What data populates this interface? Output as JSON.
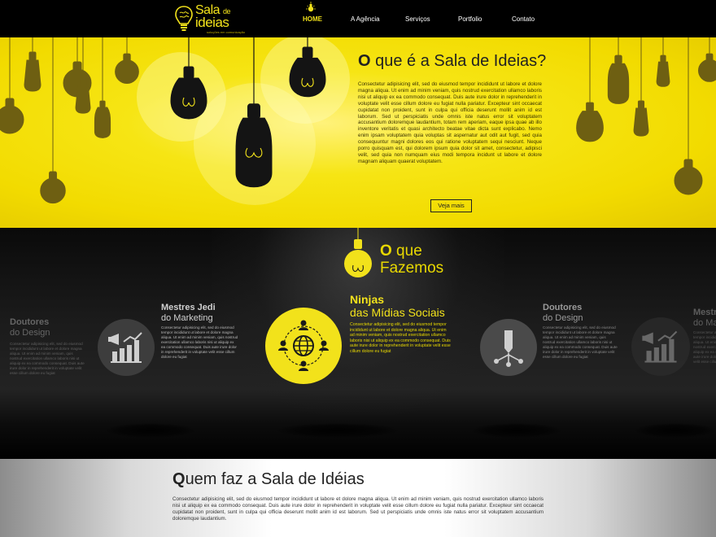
{
  "brand": {
    "name_line1": "Sala",
    "name_de": "de",
    "name_line2": "ideias",
    "tagline": "soluções em comunicação"
  },
  "nav": {
    "items": [
      {
        "label": "HOME",
        "active": true
      },
      {
        "label": "A Agência",
        "active": false
      },
      {
        "label": "Serviços",
        "active": false
      },
      {
        "label": "Portfolio",
        "active": false
      },
      {
        "label": "Contato",
        "active": false
      }
    ]
  },
  "hero": {
    "title_first": "O",
    "title_rest": " que é a Sala de Ideias?",
    "body": "Consectetur adipisicing elit, sed do eiusmod tempor incididunt ut labore et dolore magna aliqua. Ut enim ad minim veniam, quis nostrud exercitation ullamco laboris nisi ut aliquip ex ea commodo consequat. Duis aute irure dolor in reprehenderit in voluptate velit esse cillum dolore eu fugiat nulla pariatur. Excepteur sint occaecat cupidatat non proident, sunt in culpa qui officia deserunt mollit anim id est laborum. Sed ut perspiciatis unde omnis iste natus error sit voluptatem accusantium doloremque laudantium, totam rem aperiam, eaque ipsa quae ab illo inventore veritatis et quasi architecto beatae vitae dicta sunt explicabo. Nemo enim ipsam voluptatem quia voluptas sit aspernatur aut odit aut fugit, sed quia consequuntur magni dolores eos qui ratione voluptatem sequi nesciunt. Neque porro quisquam est, qui dolorem ipsum quia dolor sit amet, consectetur, adipisci velit, sed quia non numquam eius modi tempora incidunt ut labore et dolore magnam aliquam quaerat voluptatem.",
    "button": "Veja mais"
  },
  "services": {
    "heading_first": "O",
    "heading_rest": " que",
    "heading_line2": "Fazemos",
    "cards": [
      {
        "title": "Doutores",
        "subtitle": "do Design",
        "desc": "Consectetur adipisicing elit, sed do eiusmod tempor incididunt ut labore et dolore magna aliqua. Ut enim ad minim veniam, quis nostrud exercitation ullamco laboris nisi ut aliquip ex ea commodo consequat. Duis aute irure dolor in reprehenderit in voluptate velit esse cillum dolore eu fugiat",
        "icon": "pencil-network-icon"
      },
      {
        "title": "Mestres Jedi",
        "subtitle": "do Marketing",
        "desc": "Consectetur adipisicing elit, sed do eiusmod tempor incididunt ut labore et dolore magna aliqua. Ut enim ad minim veniam, quis nostrud exercitation ullamco laboris nisi ut aliquip ex ea commodo consequat. Duis aute irure dolor in reprehenderit in voluptate velit esse cillum dolore eu fugiat",
        "icon": "megaphone-chart-icon"
      },
      {
        "title": "Ninjas",
        "subtitle": "das Mídias Sociais",
        "desc": "Consectetur adipisicing elit, sed do eiusmod tempor incididunt ut labore et dolore magna aliqua. Ut enim ad minim veniam, quis nostrud exercitation ullamco laboris nisi ut aliquip ex ea commodo consequat. Duis aute irure dolor in reprehenderit in voluptate velit esse cillum dolore eu fugiat",
        "icon": "globe-people-icon"
      },
      {
        "title": "Doutores",
        "subtitle": "do Design",
        "desc": "Consectetur adipisicing elit, sed do eiusmod tempor incididunt ut labore et dolore magna aliqua. Ut enim ad minim veniam, quis nostrud exercitation ullamco laboris nisi ut aliquip ex ea commodo consequat. Duis aute irure dolor in reprehenderit in voluptate velit esse cillum dolore eu fugiat",
        "icon": "pencil-network-icon"
      },
      {
        "title": "Mestres Jedi",
        "subtitle": "do Marketing",
        "desc": "Consectetur adipisicing elit, sed do eiusmod tempor incididunt ut labore et dolore magna aliqua. Ut enim ad minim veniam, quis nostrud exercitation ullamco laboris nisi ut aliquip ex ea commodo consequat. Duis aute irure dolor in reprehenderit in voluptate velit esse cillum dolore eu fugiat",
        "icon": "megaphone-chart-icon"
      }
    ]
  },
  "about": {
    "title_first": "Q",
    "title_rest": "uem faz a Sala de Idéias",
    "body": "Consectetur adipisicing elit, sed do eiusmod tempor incididunt ut labore et dolore magna aliqua. Ut enim ad minim veniam, quis nostrud exercitation ullamco laboris nisi ut aliquip ex ea commodo consequat. Duis aute irure dolor in reprehenderit in voluptate velit esse cillum dolore eu fugiat nulla pariatur. Excepteur sint occaecat cupidatat non proident, sunt in culpa qui officia deserunt mollit anim id est laborum. Sed ut perspiciatis unde omnis iste natus error sit voluptatem accusantium doloremque laudantium."
  },
  "colors": {
    "accent": "#f2e21b",
    "hero_bg": "#f6e514",
    "dark_bg": "#1b1b1b",
    "bulb_dark": "#111111",
    "bulb_faded": "#6b5c10"
  }
}
